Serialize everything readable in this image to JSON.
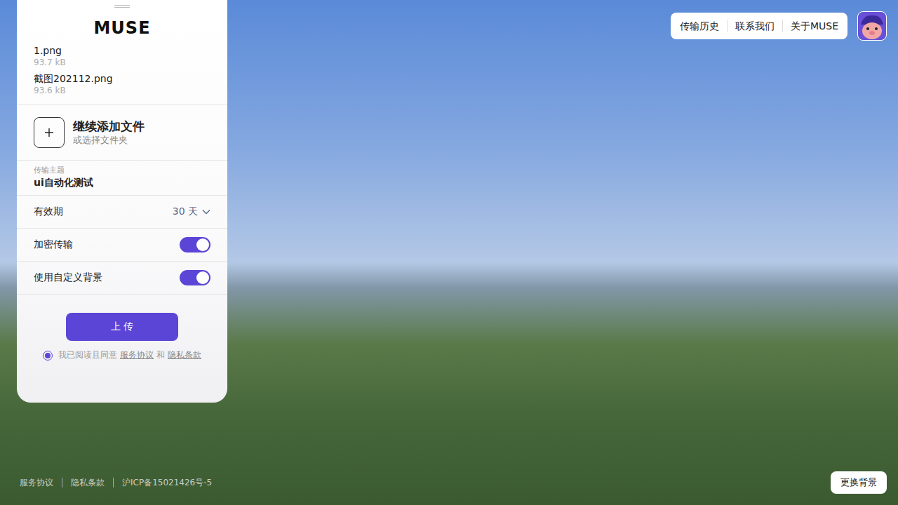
{
  "logo": "MUSE",
  "files": [
    {
      "name": "1.png",
      "size": "93.7 kB"
    },
    {
      "name": "截图202112.png",
      "size": "93.6 kB"
    }
  ],
  "add_files": {
    "title": "继续添加文件",
    "subtitle": "或选择文件夹"
  },
  "subject": {
    "label": "传输主题",
    "value": "ui自动化测试"
  },
  "settings": [
    {
      "kind": "select",
      "label": "有效期",
      "value": "30 天"
    },
    {
      "kind": "toggle",
      "label": "加密传输",
      "on": true
    },
    {
      "kind": "toggle",
      "label": "使用自定义背景",
      "on": true
    }
  ],
  "upload_button": "上 传",
  "agreement": {
    "checked": true,
    "prefix": "我已阅读且同意",
    "links": [
      "服务协议",
      "隐私条款"
    ],
    "joiner": "和"
  },
  "nav": [
    "传输历史",
    "联系我们",
    "关于MUSE"
  ],
  "footer": [
    "服务协议",
    "隐私条款",
    "沪ICP备15021426号-5"
  ],
  "change_background": "更换背景"
}
